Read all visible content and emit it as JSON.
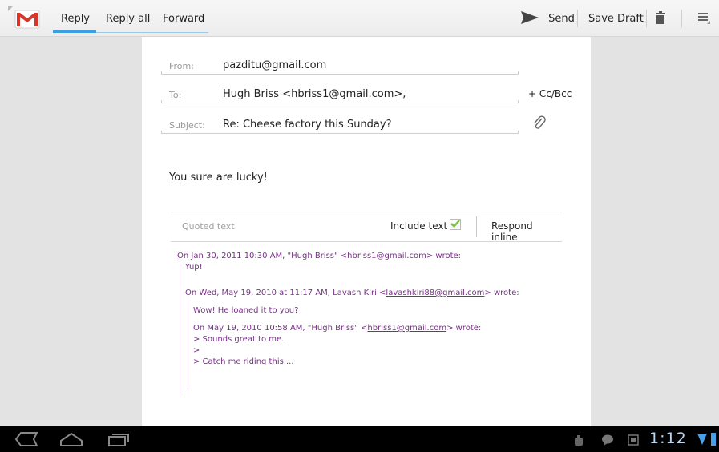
{
  "toolbar": {
    "tabs": [
      "Reply",
      "Reply all",
      "Forward"
    ],
    "send_label": "Send",
    "save_draft_label": "Save Draft"
  },
  "compose": {
    "from_label": "From:",
    "from_value": "pazditu@gmail.com",
    "to_label": "To:",
    "to_value": "Hugh Briss <hbriss1@gmail.com>,",
    "cc_bcc_label": "+ Cc/Bcc",
    "subject_label": "Subject:",
    "subject_value": "Re: Cheese factory this Sunday?",
    "body": "You sure are lucky!"
  },
  "quoted_bar": {
    "label": "Quoted text",
    "include_text": "Include text",
    "include_checked": true,
    "respond_inline": "Respond inline"
  },
  "quoted": {
    "l1": "On Jan 30, 2011 10:30 AM, \"Hugh Briss\" <hbriss1@gmail.com> wrote:",
    "l2": "Yup!",
    "l3a": "On Wed, May 19, 2010 at 11:17 AM, Lavash Kiri <",
    "l3link": "lavashkiri88@gmail.com",
    "l3b": "> wrote:",
    "l4": "Wow! He loaned it to you?",
    "l5a": "On May 19, 2010 10:58 AM, \"Hugh Briss\" <",
    "l5link": "hbriss1@gmail.com",
    "l5b": "> wrote:",
    "l6": "> Sounds great to me.",
    "l7": ">",
    "l8": "> Catch me riding this ..."
  },
  "status_bar": {
    "clock": "1:12"
  },
  "colors": {
    "accent": "#3a9ee0",
    "quoted_text": "#7b2d8b",
    "check": "#7cc23a"
  }
}
